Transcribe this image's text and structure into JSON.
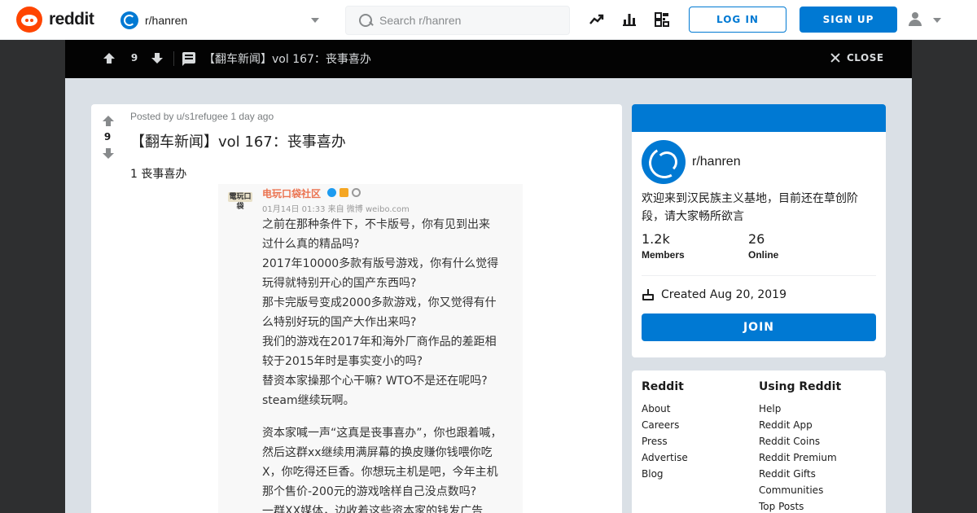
{
  "header": {
    "logo_text": "reddit",
    "community": "r/hanren",
    "search_placeholder": "Search r/hanren",
    "login_label": "LOG IN",
    "signup_label": "SIGN UP",
    "icons": [
      "trending-icon",
      "stats-icon",
      "coins-icon",
      "user-icon",
      "chevron-down-icon"
    ]
  },
  "post_bar": {
    "score": "9",
    "title": "【翻车新闻】vol 167：丧事喜办",
    "close_label": "CLOSE"
  },
  "post": {
    "score": "9",
    "meta": "Posted by u/s1refugee 1 day ago",
    "title": "【翻车新闻】vol 167：丧事喜办",
    "body": "1 丧事喜办",
    "weibo": {
      "avatar_text": "電玩口袋",
      "account_name": "电玩口袋社区",
      "date": "01月14日 01:33 来自 微博 weibo.com",
      "paragraphs": [
        [
          "之前在那种条件下，不卡版号，你有见到出来",
          "过什么真的精品吗?",
          "2017年10000多款有版号游戏，你有什么觉得",
          "玩得就特别开心的国产东西吗?",
          "那卡完版号变成2000多款游戏，你又觉得有什",
          "么特别好玩的国产大作出来吗?",
          "我们的游戏在2017年和海外厂商作品的差距相",
          "较于2015年时是事实变小的吗?",
          "替资本家操那个心干嘛? WTO不是还在呢吗?",
          "steam继续玩啊。"
        ],
        [
          "资本家喊一声“这真是丧事喜办”，你也跟着喊，",
          "然后这群xx继续用满屏幕的换皮赚你钱喂你吃",
          "X，你吃得还巨香。你想玩主机是吧，今年主机",
          "那个售价-200元的游戏啥样自己没点数吗?",
          "一群XX媒体，边收着这些资本家的钱发广告"
        ]
      ]
    }
  },
  "about": {
    "name": "r/hanren",
    "description": "欢迎来到汉民族主义基地，目前还在草创阶段，请大家畅所欲言",
    "members_value": "1.2k",
    "members_label": "Members",
    "online_value": "26",
    "online_label": "Online",
    "created": "Created Aug 20, 2019",
    "join_label": "JOIN"
  },
  "links": {
    "col1_title": "Reddit",
    "col1": [
      "About",
      "Careers",
      "Press",
      "Advertise",
      "Blog"
    ],
    "col2_title": "Using Reddit",
    "col2": [
      "Help",
      "Reddit App",
      "Reddit Coins",
      "Reddit Premium",
      "Reddit Gifts",
      "Communities",
      "Top Posts"
    ]
  },
  "colors": {
    "brand": "#ff4500",
    "accent": "#0079d3",
    "overlay": "#030303",
    "canvas": "#dae0e6"
  }
}
